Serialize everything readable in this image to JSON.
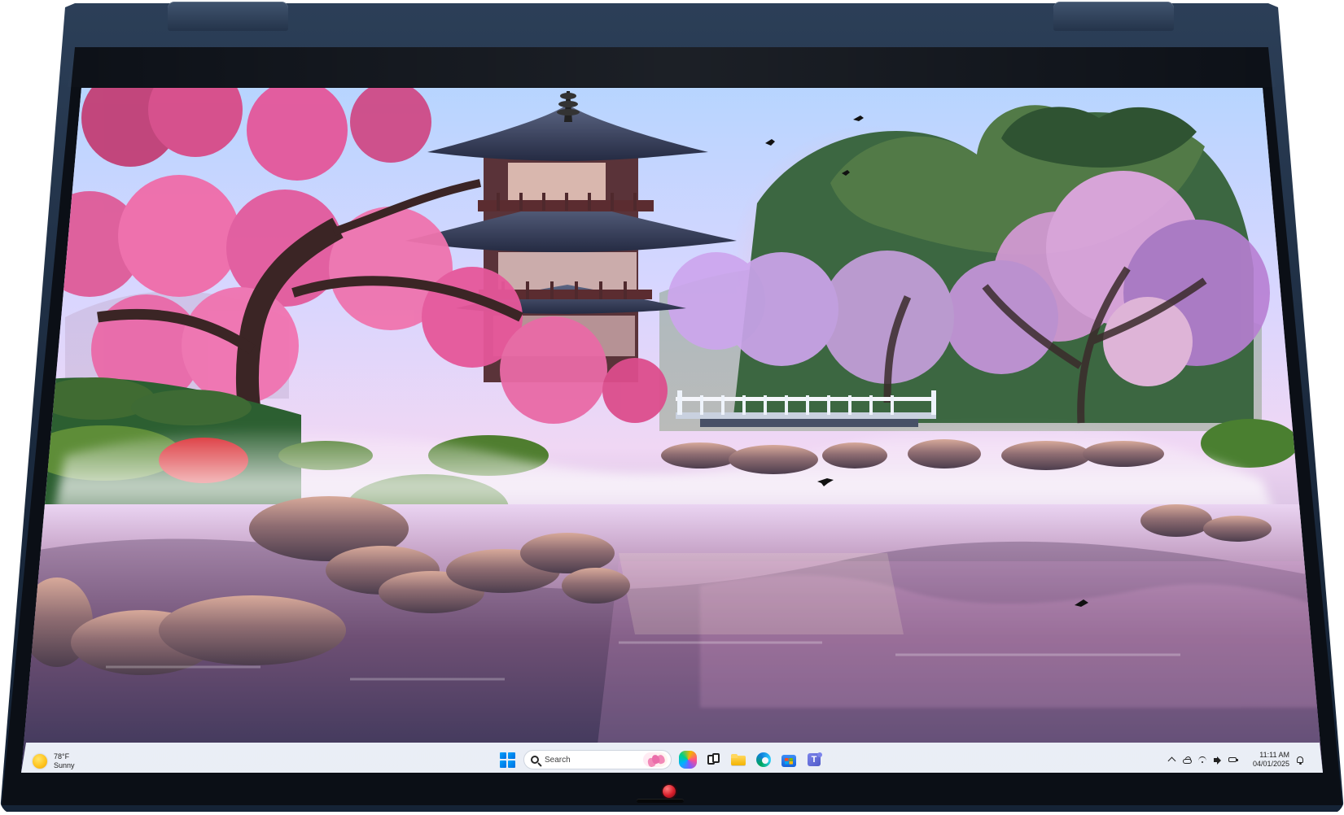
{
  "desktop": {
    "wallpaper_icon": "landscape-wallpaper"
  },
  "taskbar": {
    "weather": {
      "temperature": "78°F",
      "condition": "Sunny",
      "icon": "sun-icon"
    },
    "search": {
      "placeholder": "Search",
      "icon": "search-icon",
      "highlight_icon": "lotus-icon"
    },
    "pinned_icons": [
      "start-icon",
      "copilot-icon",
      "task-view-icon",
      "file-explorer-icon",
      "edge-icon",
      "store-icon",
      "teams-icon"
    ],
    "system_tray": {
      "icons": [
        "chevron-up-icon",
        "cloud-icon",
        "wifi-icon",
        "volume-icon",
        "battery-icon",
        "bell-icon"
      ],
      "time": "11:11 AM",
      "date": "04/01/2025"
    }
  },
  "device": {
    "camera_color": "#d71d2a",
    "chassis_color": "#22344b"
  }
}
